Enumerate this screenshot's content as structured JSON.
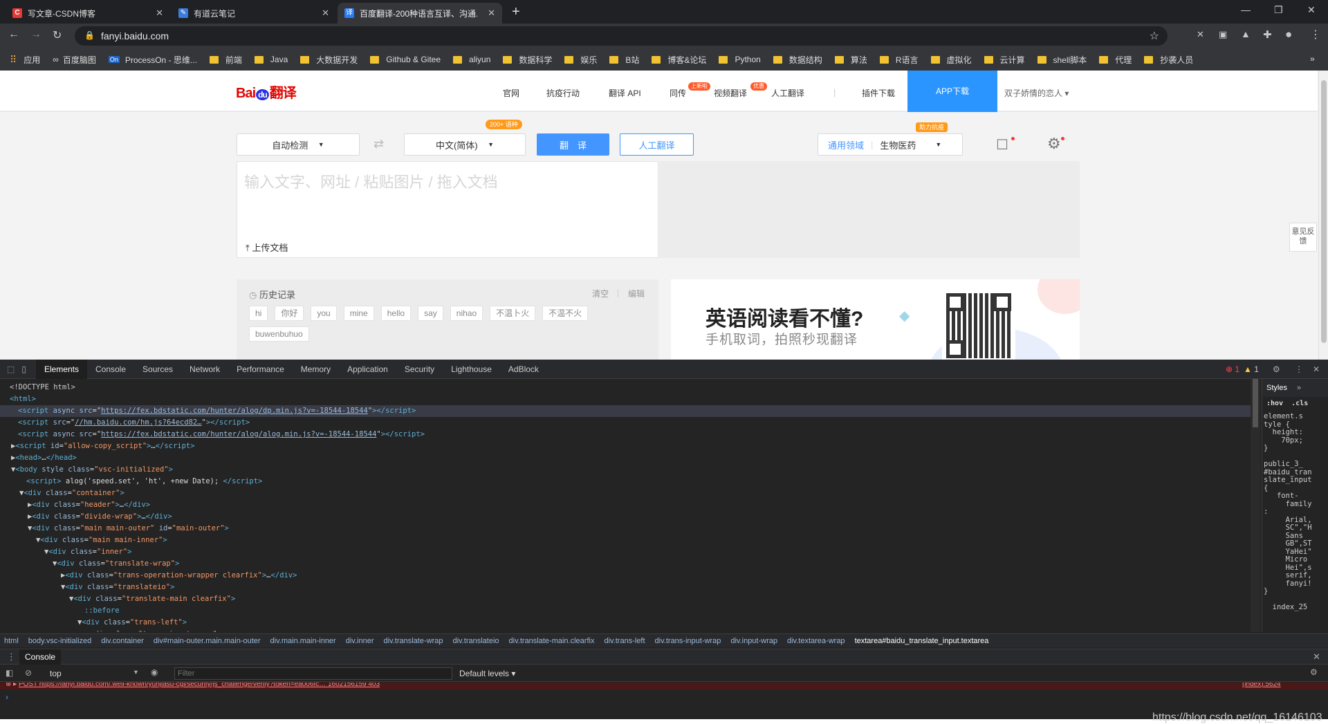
{
  "browser": {
    "tabs": [
      {
        "title": "写文章-CSDN博客",
        "fav": "C",
        "favcolor": "#e53935"
      },
      {
        "title": "有道云笔记",
        "fav": "✎",
        "favcolor": "#3b7ddd"
      },
      {
        "title": "百度翻译-200种语言互译、沟通...",
        "fav": "译",
        "favcolor": "#2b7bf5"
      }
    ],
    "new_tab": "+",
    "url": "fanyi.baidu.com",
    "bookmarks": [
      "应用",
      "百度脑图",
      "ProcessOn - 思维...",
      "前端",
      "Java",
      "大数据开发",
      "Github & Gitee",
      "aliyun",
      "数据科学",
      "娱乐",
      "B站",
      "博客&论坛",
      "Python",
      "数据结构",
      "算法",
      "R语言",
      "虚拟化",
      "云计算",
      "shell脚本",
      "代理",
      "抄袭人员"
    ],
    "more": "»"
  },
  "baidu": {
    "logo_bai": "Bai",
    "logo_du": "du",
    "logo_fy": "翻译",
    "nav": [
      "官网",
      "抗疫行动",
      "翻译 API",
      "同传",
      "视频翻译",
      "人工翻译",
      "插件下载"
    ],
    "badge_tc": "上新啦",
    "badge_sp": "优惠",
    "app": "APP下载",
    "user": "双子娇情的恋人",
    "src_lang": "自动检测",
    "tgt_lang": "中文(简体)",
    "lang_count": "200+ 语种",
    "translate_btn": "翻　译",
    "human_btn": "人工翻译",
    "domain_general": "通用领域",
    "domain_sel": "生物医药",
    "domain_badge": "助力抗疫",
    "input_placeholder": "输入文字、网址 / 粘贴图片 / 拖入文档",
    "upload": "上传文档",
    "feedback": "意见反馈",
    "history_title": "历史记录",
    "clear": "清空",
    "edit": "编辑",
    "history": [
      "hi",
      "你好",
      "you",
      "mine",
      "hello",
      "say",
      "nihao",
      "不温卜火",
      "不温不火",
      "buwenbuhuo"
    ],
    "ad_title": "英语阅读看不懂?",
    "ad_sub": "手机取词，拍照秒现翻译"
  },
  "devtools": {
    "tabs": [
      "Elements",
      "Console",
      "Sources",
      "Network",
      "Performance",
      "Memory",
      "Application",
      "Security",
      "Lighthouse",
      "AdBlock"
    ],
    "errors": "1",
    "warnings": "1",
    "styles_tab": "Styles",
    "styles_more": "»",
    "hov": ":hov",
    "cls": ".cls",
    "styles_lines": [
      "element.s",
      "tyle {",
      "  height:",
      "    70px;",
      "}",
      "",
      "public_3_",
      "#baidu_tran",
      "slate_input",
      "{",
      "   font-",
      "     family",
      ":",
      "     Arial,",
      "     SC\",\"H",
      "     Sans",
      "     GB\",ST",
      "     YaHei\"",
      "     Micro",
      "     Hei\",s",
      "     serif,",
      "     fanyi!",
      "}",
      "",
      "  index_25"
    ],
    "breadcrumbs": [
      "html",
      "body.vsc-initialized",
      "div.container",
      "div#main-outer.main.main-outer",
      "div.main.main-inner",
      "div.inner",
      "div.translate-wrap",
      "div.translateio",
      "div.translate-main.clearfix",
      "div.trans-left",
      "div.trans-input-wrap",
      "div.input-wrap",
      "div.textarea-wrap",
      "textarea#baidu_translate_input.textarea"
    ],
    "console_tab": "Console",
    "context": "top",
    "filter_ph": "Filter",
    "levels": "Default levels ▾",
    "err_line": "POST https://fanyi.baidu.com/.well-known/yunjiasu-cgi/security/js_challenge/verify?token=ea006fc… 1602156159 403",
    "err_src": "(index):5624",
    "watermark": "https://blog.csdn.net/qq_16146103"
  }
}
